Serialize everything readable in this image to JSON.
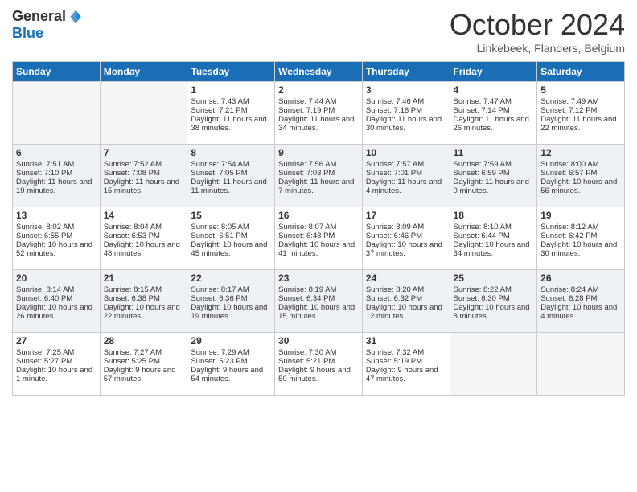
{
  "logo": {
    "general": "General",
    "blue": "Blue"
  },
  "title": "October 2024",
  "subtitle": "Linkebeek, Flanders, Belgium",
  "days_of_week": [
    "Sunday",
    "Monday",
    "Tuesday",
    "Wednesday",
    "Thursday",
    "Friday",
    "Saturday"
  ],
  "weeks": [
    {
      "days": [
        {
          "num": "",
          "empty": true
        },
        {
          "num": "",
          "empty": true
        },
        {
          "num": "1",
          "sunrise": "Sunrise: 7:43 AM",
          "sunset": "Sunset: 7:21 PM",
          "daylight": "Daylight: 11 hours and 38 minutes."
        },
        {
          "num": "2",
          "sunrise": "Sunrise: 7:44 AM",
          "sunset": "Sunset: 7:19 PM",
          "daylight": "Daylight: 11 hours and 34 minutes."
        },
        {
          "num": "3",
          "sunrise": "Sunrise: 7:46 AM",
          "sunset": "Sunset: 7:16 PM",
          "daylight": "Daylight: 11 hours and 30 minutes."
        },
        {
          "num": "4",
          "sunrise": "Sunrise: 7:47 AM",
          "sunset": "Sunset: 7:14 PM",
          "daylight": "Daylight: 11 hours and 26 minutes."
        },
        {
          "num": "5",
          "sunrise": "Sunrise: 7:49 AM",
          "sunset": "Sunset: 7:12 PM",
          "daylight": "Daylight: 11 hours and 22 minutes."
        }
      ]
    },
    {
      "days": [
        {
          "num": "6",
          "sunrise": "Sunrise: 7:51 AM",
          "sunset": "Sunset: 7:10 PM",
          "daylight": "Daylight: 11 hours and 19 minutes."
        },
        {
          "num": "7",
          "sunrise": "Sunrise: 7:52 AM",
          "sunset": "Sunset: 7:08 PM",
          "daylight": "Daylight: 11 hours and 15 minutes."
        },
        {
          "num": "8",
          "sunrise": "Sunrise: 7:54 AM",
          "sunset": "Sunset: 7:05 PM",
          "daylight": "Daylight: 11 hours and 11 minutes."
        },
        {
          "num": "9",
          "sunrise": "Sunrise: 7:56 AM",
          "sunset": "Sunset: 7:03 PM",
          "daylight": "Daylight: 11 hours and 7 minutes."
        },
        {
          "num": "10",
          "sunrise": "Sunrise: 7:57 AM",
          "sunset": "Sunset: 7:01 PM",
          "daylight": "Daylight: 11 hours and 4 minutes."
        },
        {
          "num": "11",
          "sunrise": "Sunrise: 7:59 AM",
          "sunset": "Sunset: 6:59 PM",
          "daylight": "Daylight: 11 hours and 0 minutes."
        },
        {
          "num": "12",
          "sunrise": "Sunrise: 8:00 AM",
          "sunset": "Sunset: 6:57 PM",
          "daylight": "Daylight: 10 hours and 56 minutes."
        }
      ]
    },
    {
      "days": [
        {
          "num": "13",
          "sunrise": "Sunrise: 8:02 AM",
          "sunset": "Sunset: 6:55 PM",
          "daylight": "Daylight: 10 hours and 52 minutes."
        },
        {
          "num": "14",
          "sunrise": "Sunrise: 8:04 AM",
          "sunset": "Sunset: 6:53 PM",
          "daylight": "Daylight: 10 hours and 48 minutes."
        },
        {
          "num": "15",
          "sunrise": "Sunrise: 8:05 AM",
          "sunset": "Sunset: 6:51 PM",
          "daylight": "Daylight: 10 hours and 45 minutes."
        },
        {
          "num": "16",
          "sunrise": "Sunrise: 8:07 AM",
          "sunset": "Sunset: 6:48 PM",
          "daylight": "Daylight: 10 hours and 41 minutes."
        },
        {
          "num": "17",
          "sunrise": "Sunrise: 8:09 AM",
          "sunset": "Sunset: 6:46 PM",
          "daylight": "Daylight: 10 hours and 37 minutes."
        },
        {
          "num": "18",
          "sunrise": "Sunrise: 8:10 AM",
          "sunset": "Sunset: 6:44 PM",
          "daylight": "Daylight: 10 hours and 34 minutes."
        },
        {
          "num": "19",
          "sunrise": "Sunrise: 8:12 AM",
          "sunset": "Sunset: 6:42 PM",
          "daylight": "Daylight: 10 hours and 30 minutes."
        }
      ]
    },
    {
      "days": [
        {
          "num": "20",
          "sunrise": "Sunrise: 8:14 AM",
          "sunset": "Sunset: 6:40 PM",
          "daylight": "Daylight: 10 hours and 26 minutes."
        },
        {
          "num": "21",
          "sunrise": "Sunrise: 8:15 AM",
          "sunset": "Sunset: 6:38 PM",
          "daylight": "Daylight: 10 hours and 22 minutes."
        },
        {
          "num": "22",
          "sunrise": "Sunrise: 8:17 AM",
          "sunset": "Sunset: 6:36 PM",
          "daylight": "Daylight: 10 hours and 19 minutes."
        },
        {
          "num": "23",
          "sunrise": "Sunrise: 8:19 AM",
          "sunset": "Sunset: 6:34 PM",
          "daylight": "Daylight: 10 hours and 15 minutes."
        },
        {
          "num": "24",
          "sunrise": "Sunrise: 8:20 AM",
          "sunset": "Sunset: 6:32 PM",
          "daylight": "Daylight: 10 hours and 12 minutes."
        },
        {
          "num": "25",
          "sunrise": "Sunrise: 8:22 AM",
          "sunset": "Sunset: 6:30 PM",
          "daylight": "Daylight: 10 hours and 8 minutes."
        },
        {
          "num": "26",
          "sunrise": "Sunrise: 8:24 AM",
          "sunset": "Sunset: 6:28 PM",
          "daylight": "Daylight: 10 hours and 4 minutes."
        }
      ]
    },
    {
      "days": [
        {
          "num": "27",
          "sunrise": "Sunrise: 7:25 AM",
          "sunset": "Sunset: 5:27 PM",
          "daylight": "Daylight: 10 hours and 1 minute."
        },
        {
          "num": "28",
          "sunrise": "Sunrise: 7:27 AM",
          "sunset": "Sunset: 5:25 PM",
          "daylight": "Daylight: 9 hours and 57 minutes."
        },
        {
          "num": "29",
          "sunrise": "Sunrise: 7:29 AM",
          "sunset": "Sunset: 5:23 PM",
          "daylight": "Daylight: 9 hours and 54 minutes."
        },
        {
          "num": "30",
          "sunrise": "Sunrise: 7:30 AM",
          "sunset": "Sunset: 5:21 PM",
          "daylight": "Daylight: 9 hours and 50 minutes."
        },
        {
          "num": "31",
          "sunrise": "Sunrise: 7:32 AM",
          "sunset": "Sunset: 5:19 PM",
          "daylight": "Daylight: 9 hours and 47 minutes."
        },
        {
          "num": "",
          "empty": true
        },
        {
          "num": "",
          "empty": true
        }
      ]
    }
  ]
}
